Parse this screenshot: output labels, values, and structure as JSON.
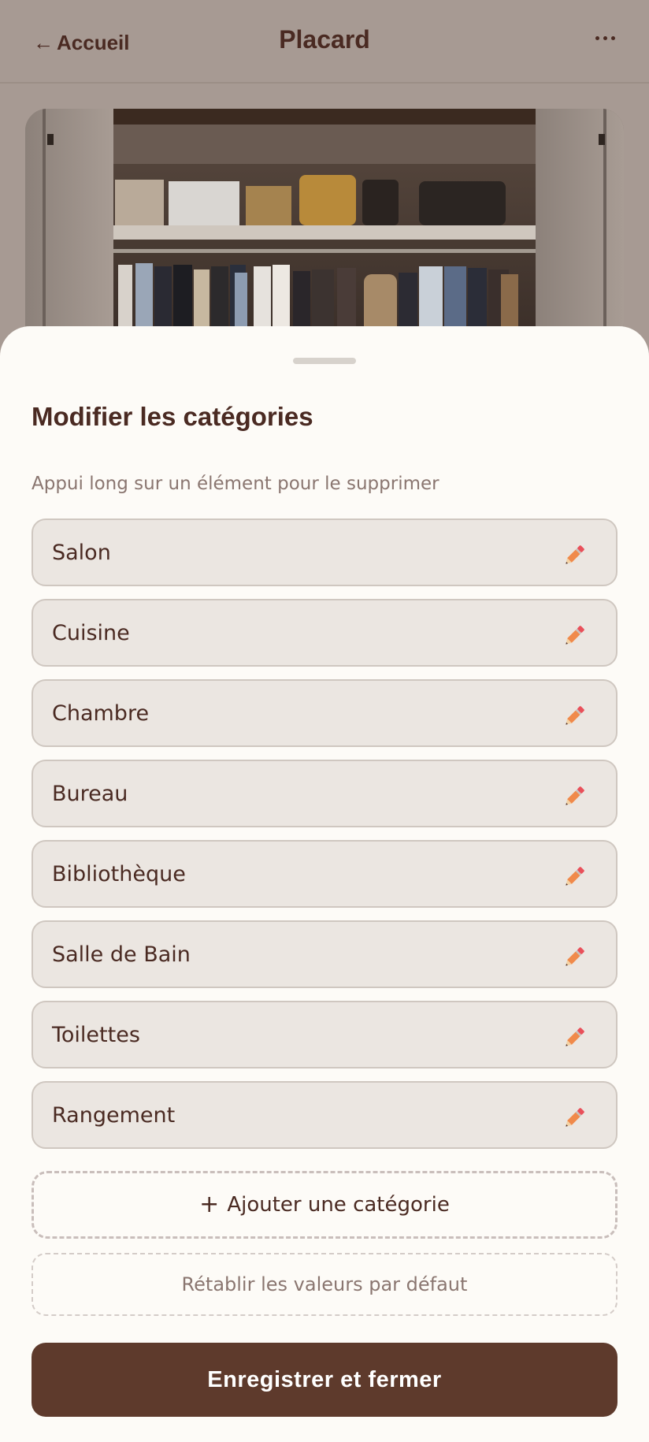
{
  "header": {
    "back_arrow": "←",
    "back_label": "Accueil",
    "title": "Placard",
    "more_icon": "more-horizontal-icon"
  },
  "sheet": {
    "title": "Modifier les catégories",
    "hint": "Appui long sur un élément pour le supprimer",
    "categories": [
      {
        "label": "Salon"
      },
      {
        "label": "Cuisine"
      },
      {
        "label": "Chambre"
      },
      {
        "label": "Bureau"
      },
      {
        "label": "Bibliothèque"
      },
      {
        "label": "Salle de Bain"
      },
      {
        "label": "Toilettes"
      },
      {
        "label": "Rangement"
      }
    ],
    "add_plus": "+",
    "add_label": "Ajouter une catégorie",
    "reset_label": "Rétablir les valeurs par défaut",
    "save_label": "Enregistrer et fermer"
  },
  "colors": {
    "header_bg": "#a79a93",
    "text_primary": "#4a2a22",
    "sheet_bg": "#fdfbf7",
    "item_bg": "#ebe6e1",
    "primary_button": "#5e3a2c",
    "edit_icon": "#f08a4b"
  }
}
